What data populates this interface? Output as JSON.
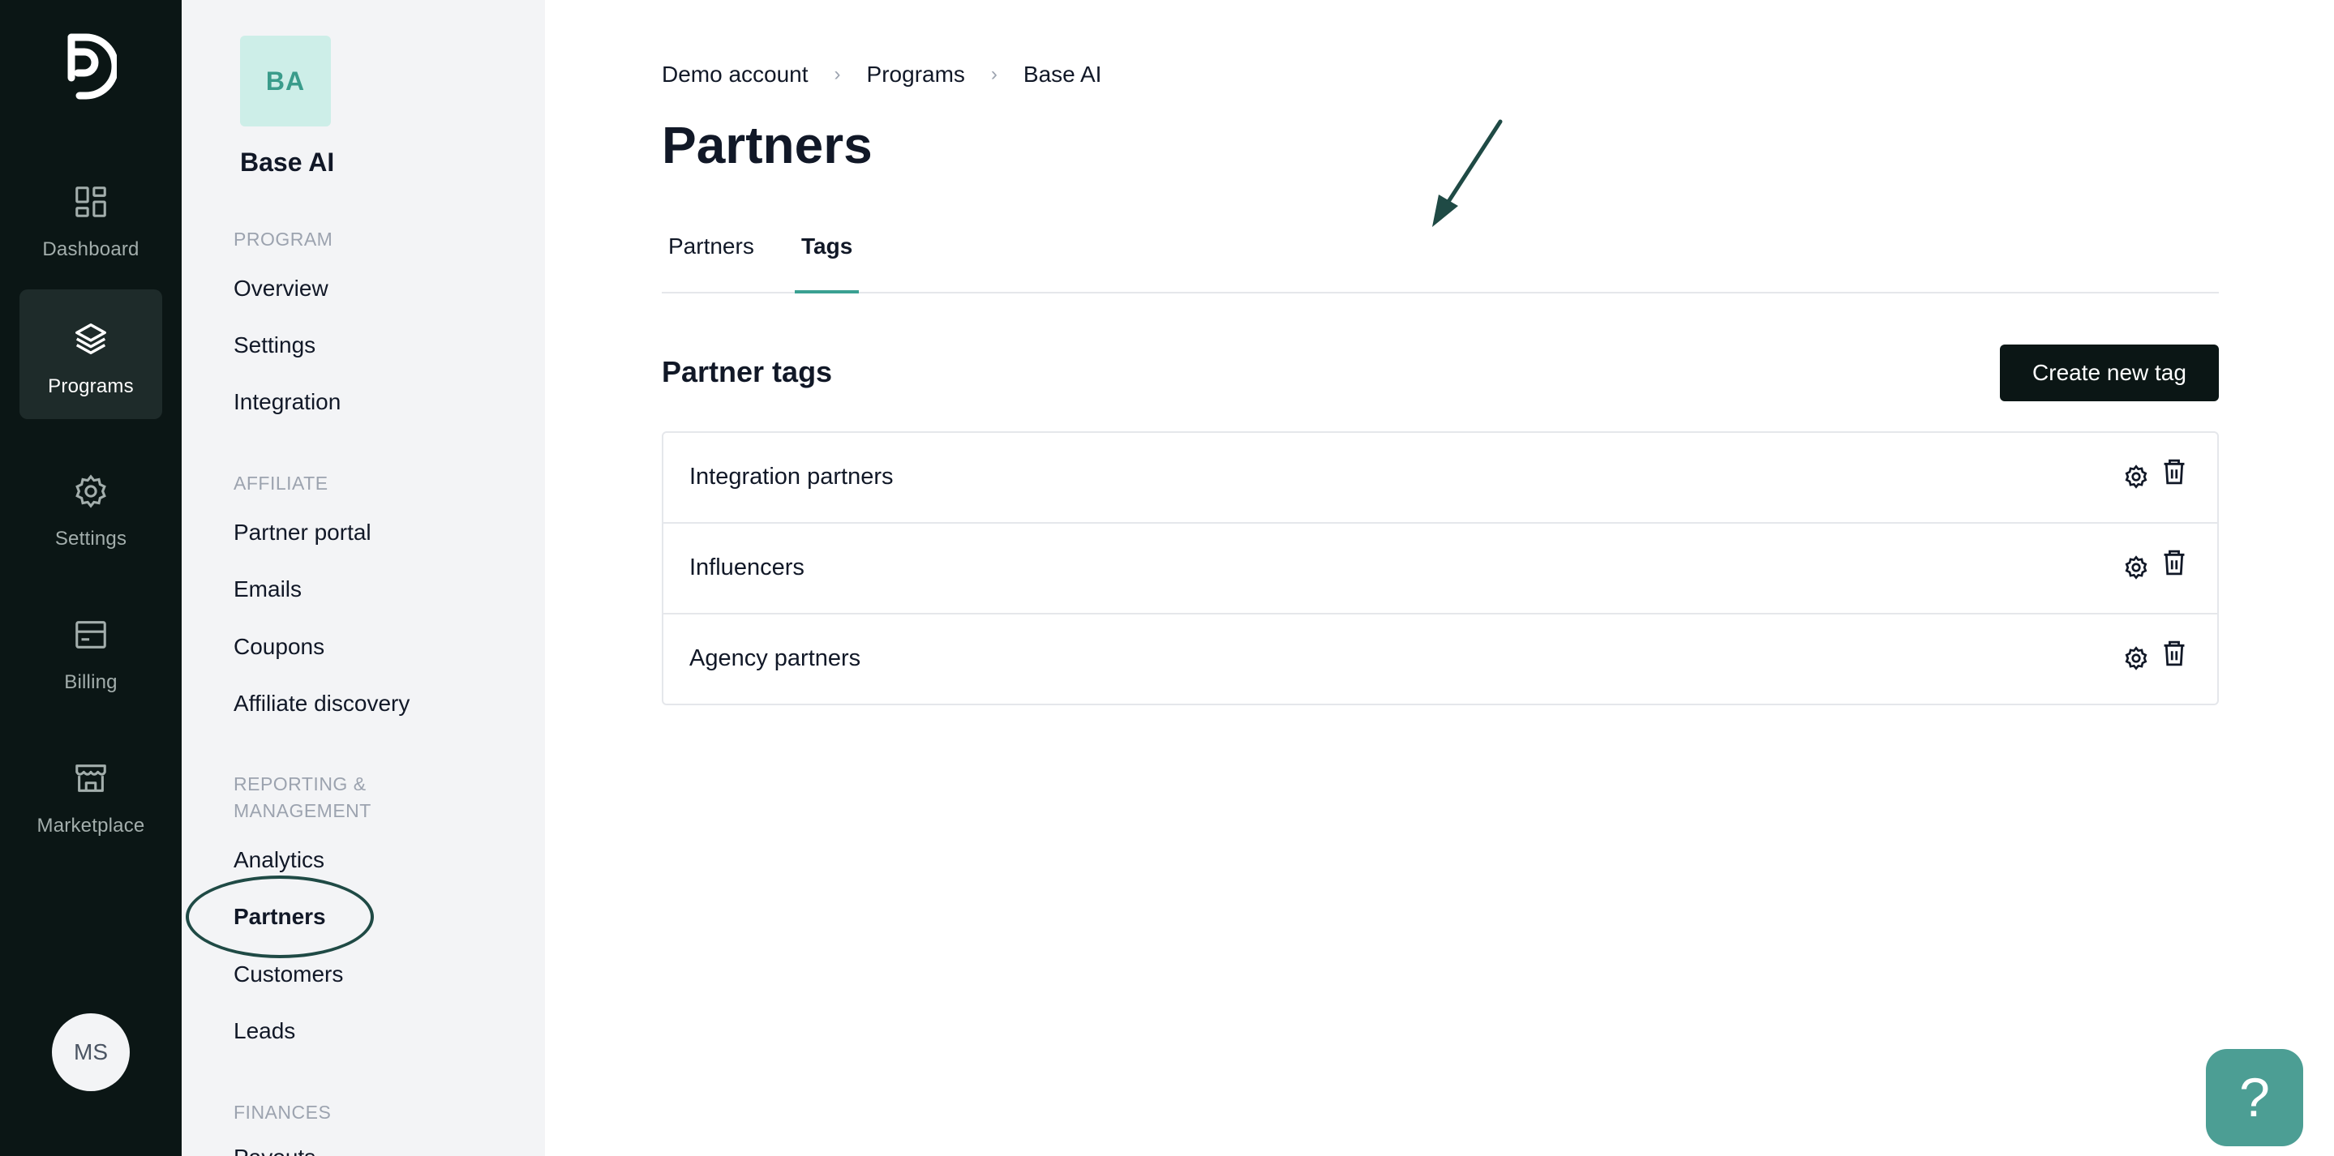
{
  "rail": {
    "items": [
      {
        "label": "Dashboard",
        "icon": "dashboard-icon"
      },
      {
        "label": "Programs",
        "icon": "layers-icon",
        "active": true
      },
      {
        "label": "Settings",
        "icon": "gear-icon"
      },
      {
        "label": "Billing",
        "icon": "billing-icon"
      },
      {
        "label": "Marketplace",
        "icon": "store-icon"
      }
    ],
    "avatar": "MS"
  },
  "program": {
    "badge": "BA",
    "name": "Base AI"
  },
  "sidebar": {
    "sections": [
      {
        "title": "PROGRAM",
        "items": [
          "Overview",
          "Settings",
          "Integration"
        ]
      },
      {
        "title": "AFFILIATE",
        "items": [
          "Partner portal",
          "Emails",
          "Coupons",
          "Affiliate discovery"
        ]
      },
      {
        "title": "REPORTING & MANAGEMENT",
        "items": [
          "Analytics",
          "Partners",
          "Customers",
          "Leads"
        ]
      },
      {
        "title": "FINANCES",
        "items": [
          "Payouts"
        ]
      }
    ],
    "active_item": "Partners"
  },
  "breadcrumb": [
    "Demo account",
    "Programs",
    "Base AI"
  ],
  "page_title": "Partners",
  "tabs": [
    {
      "label": "Partners"
    },
    {
      "label": "Tags",
      "active": true
    }
  ],
  "section": {
    "title": "Partner tags",
    "create_button": "Create new tag"
  },
  "tags": [
    {
      "name": "Integration partners"
    },
    {
      "name": "Influencers"
    },
    {
      "name": "Agency partners"
    }
  ],
  "help_label": "?",
  "colors": {
    "rail_bg": "#0b1615",
    "accent": "#3aa192",
    "badge_bg": "#cdeee8",
    "help_bg": "#4c9e94",
    "annotation": "#1f4a45"
  }
}
